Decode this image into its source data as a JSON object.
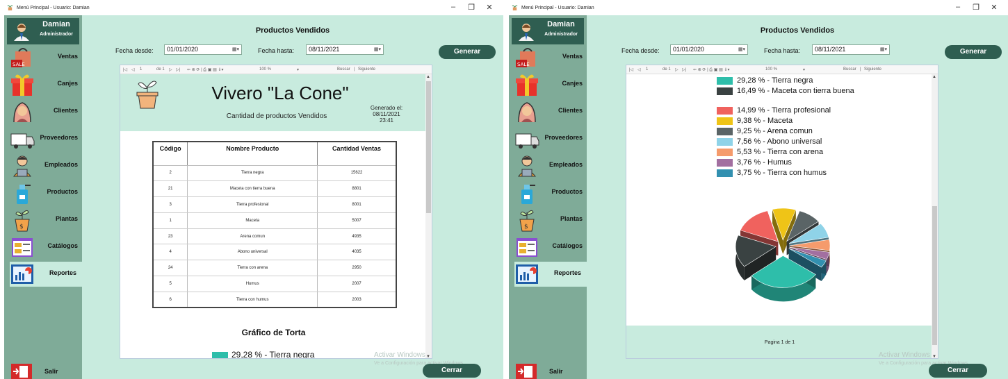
{
  "window_title": "Menú Principal - Usuario: Damian",
  "window_controls": {
    "minimize": "–",
    "maximize": "❐",
    "close": "✕"
  },
  "user": {
    "name": "Damian",
    "role": "Administrador"
  },
  "nav": [
    {
      "label": "Ventas",
      "icon": "sale-bag-icon"
    },
    {
      "label": "Canjes",
      "icon": "gift-icon"
    },
    {
      "label": "Clientes",
      "icon": "customer-icon"
    },
    {
      "label": "Proveedores",
      "icon": "truck-icon"
    },
    {
      "label": "Empleados",
      "icon": "employee-icon"
    },
    {
      "label": "Productos",
      "icon": "spray-bottle-icon"
    },
    {
      "label": "Plantas",
      "icon": "plant-pot-icon"
    },
    {
      "label": "Catálogos",
      "icon": "catalog-icon"
    },
    {
      "label": "Reportes",
      "icon": "report-chart-icon"
    }
  ],
  "nav_active": "Reportes",
  "exit_label": "Salir",
  "screen_title": "Productos Vendidos",
  "filters": {
    "from_label": "Fecha desde:",
    "from_value": "01/01/2020",
    "to_label": "Fecha hasta:",
    "to_value": "08/11/2021",
    "calendar_glyph": "▦▾"
  },
  "generate_label": "Generar",
  "close_label": "Cerrar",
  "viewer_toolbar": {
    "first": "|◁",
    "prev": "◁",
    "page_input": "1",
    "page_of": "de 1",
    "next": "▷",
    "last": "▷|",
    "tools": "⇐ ⊗ ⟳ | ⎙ ▣ ▤ ⇓▾",
    "zoom": "100 %",
    "zoom_arrow": "▾",
    "search": "Buscar",
    "search_next": "Siguiente",
    "separator": "|"
  },
  "report": {
    "title": "Vivero \"La Cone\"",
    "subtitle": "Cantidad de productos Vendidos",
    "generated_label": "Generado el:",
    "generated_date": "08/11/2021",
    "generated_time": "23:41",
    "table": {
      "headers": [
        "Código",
        "Nombre Producto",
        "Cantidad Ventas"
      ],
      "rows": [
        [
          "2",
          "Tierra negra",
          "15622"
        ],
        [
          "21",
          "Maceta con tierra buena",
          "8801"
        ],
        [
          "3",
          "Tierra profesional",
          "8001"
        ],
        [
          "1",
          "Maceta",
          "5007"
        ],
        [
          "23",
          "Arena comun",
          "4935"
        ],
        [
          "4",
          "Abono universal",
          "4035"
        ],
        [
          "24",
          "Tierra con arena",
          "2950"
        ],
        [
          "5",
          "Humus",
          "2007"
        ],
        [
          "6",
          "Tierra con humus",
          "2003"
        ]
      ]
    },
    "chart_title": "Gráfico de Torta",
    "page_label": "Pagina 1 de 1"
  },
  "chart_data": {
    "type": "pie",
    "title": "Gráfico de Torta",
    "categories": [
      "Tierra negra",
      "Maceta con tierra buena",
      "Tierra profesional",
      "Maceta",
      "Arena comun",
      "Abono universal",
      "Tierra con arena",
      "Humus",
      "Tierra con humus"
    ],
    "values": [
      29.28,
      16.49,
      14.99,
      9.38,
      9.25,
      7.56,
      5.53,
      3.76,
      3.75
    ],
    "legend_labels": [
      "29,28 % - Tierra negra",
      "16,49 % - Maceta con tierra buena",
      "14,99 % - Tierra profesional",
      "9,38 % - Maceta",
      "9,25 % - Arena comun",
      "7,56 % - Abono universal",
      "5,53 % - Tierra con arena",
      "3,76 % - Humus",
      "3,75 % - Tierra con humus"
    ],
    "colors": [
      "#2ebeaa",
      "#3a4242",
      "#f0625e",
      "#efc417",
      "#5a6466",
      "#8fd3e8",
      "#f59b6c",
      "#a26fa0",
      "#3290b0"
    ],
    "legend_placement": "top",
    "style": "exploded-3d"
  },
  "watermark": {
    "line1": "Activar Windows",
    "line2": "Ve a Configuración para activar Windows."
  }
}
